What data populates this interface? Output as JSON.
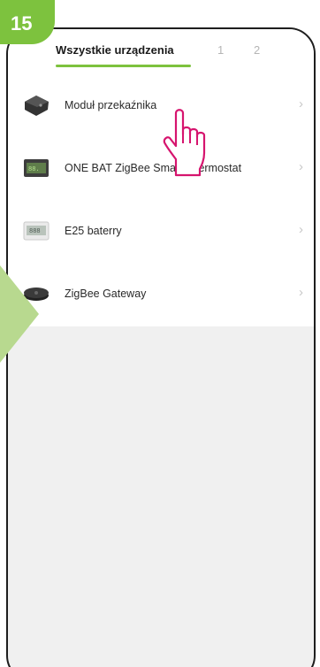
{
  "step_number": "15",
  "tabs": {
    "active": "Wszystkie urządzenia",
    "other": [
      "1",
      "2"
    ]
  },
  "devices": [
    {
      "name": "Moduł przekaźnika",
      "icon": "relay-module-icon"
    },
    {
      "name": "ONE BAT ZigBee Smart Thermostat",
      "icon": "thermostat-icon"
    },
    {
      "name": "E25 baterry",
      "icon": "thermostat-display-icon"
    },
    {
      "name": "ZigBee Gateway",
      "icon": "gateway-icon"
    }
  ],
  "colors": {
    "accent": "#7dc23e",
    "pointer": "#d6146e"
  }
}
